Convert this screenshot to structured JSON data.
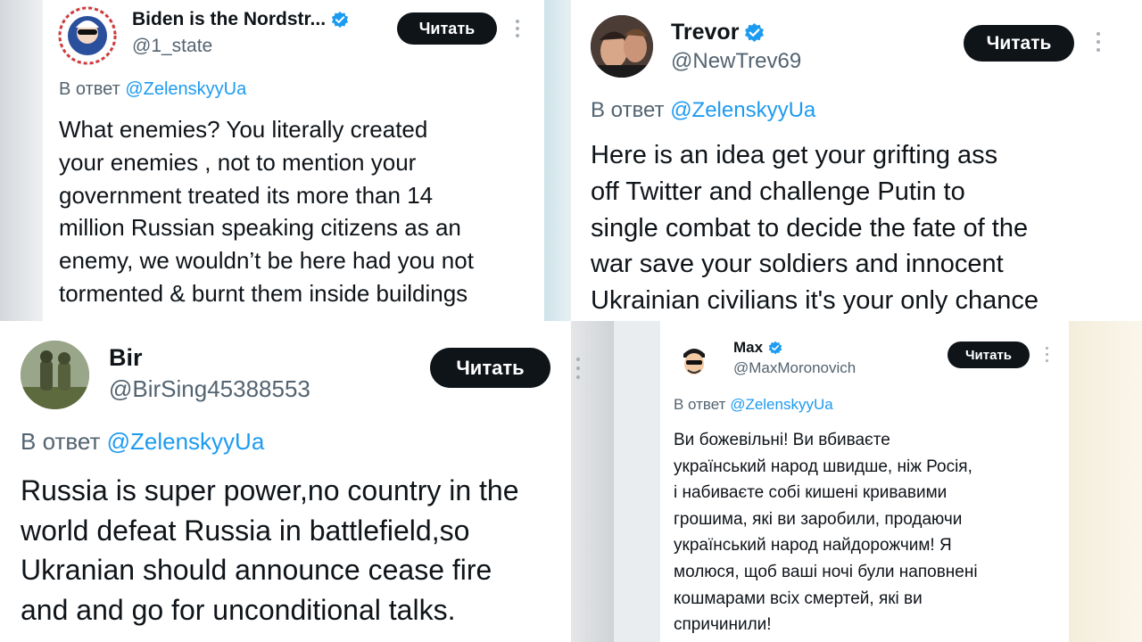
{
  "follow_label": "Читать",
  "reply_prefix": "В ответ",
  "reply_handle": "@ZelenskyyUa",
  "colors": {
    "follow_bg": "#0f1419",
    "link": "#1d9bf0",
    "verified": "#1d9bf0",
    "muted": "#536471"
  },
  "tweets": [
    {
      "name": "Biden is the Nordstr...",
      "handle": "@1_state",
      "avatar_icon": "mascot-avatar-icon",
      "lines": [
        "What enemies? You literally created",
        "your enemies , not to mention your",
        "government treated its more than 14",
        "million Russian speaking citizens  as an",
        "enemy, we wouldn’t be here had you not",
        "tormented & burnt them inside buildings"
      ]
    },
    {
      "name": "Trevor",
      "handle": "@NewTrev69",
      "avatar_icon": "selfie-avatar-icon",
      "lines": [
        "Here is an idea get your grifting ass",
        "off Twitter and challenge Putin to",
        "single combat to decide the fate of the",
        "war save your soldiers and innocent",
        "Ukrainian civilians it's your only chance"
      ]
    },
    {
      "name": "Bir",
      "handle": "@BirSing45388553",
      "avatar_icon": "soldiers-avatar-icon",
      "lines": [
        "Russia is super power,no country in the",
        "world defeat Russia in battlefield,so",
        "Ukranian should announce cease fire",
        "and and go for unconditional talks."
      ]
    },
    {
      "name": "Max",
      "handle": "@MaxMoronovich",
      "avatar_icon": "cartoon-avatar-icon",
      "lines": [
        "Ви божевільні! Ви вбиваєте",
        "український народ швидше, ніж Росія,",
        "і набиваєте собі кишені кривавими",
        "грошима, які ви заробили, продаючи",
        "український народ найдорожчим! Я",
        "молюся, щоб ваші ночі були наповнені",
        "кошмарами всіх смертей, які ви",
        "спричинили!"
      ]
    }
  ]
}
